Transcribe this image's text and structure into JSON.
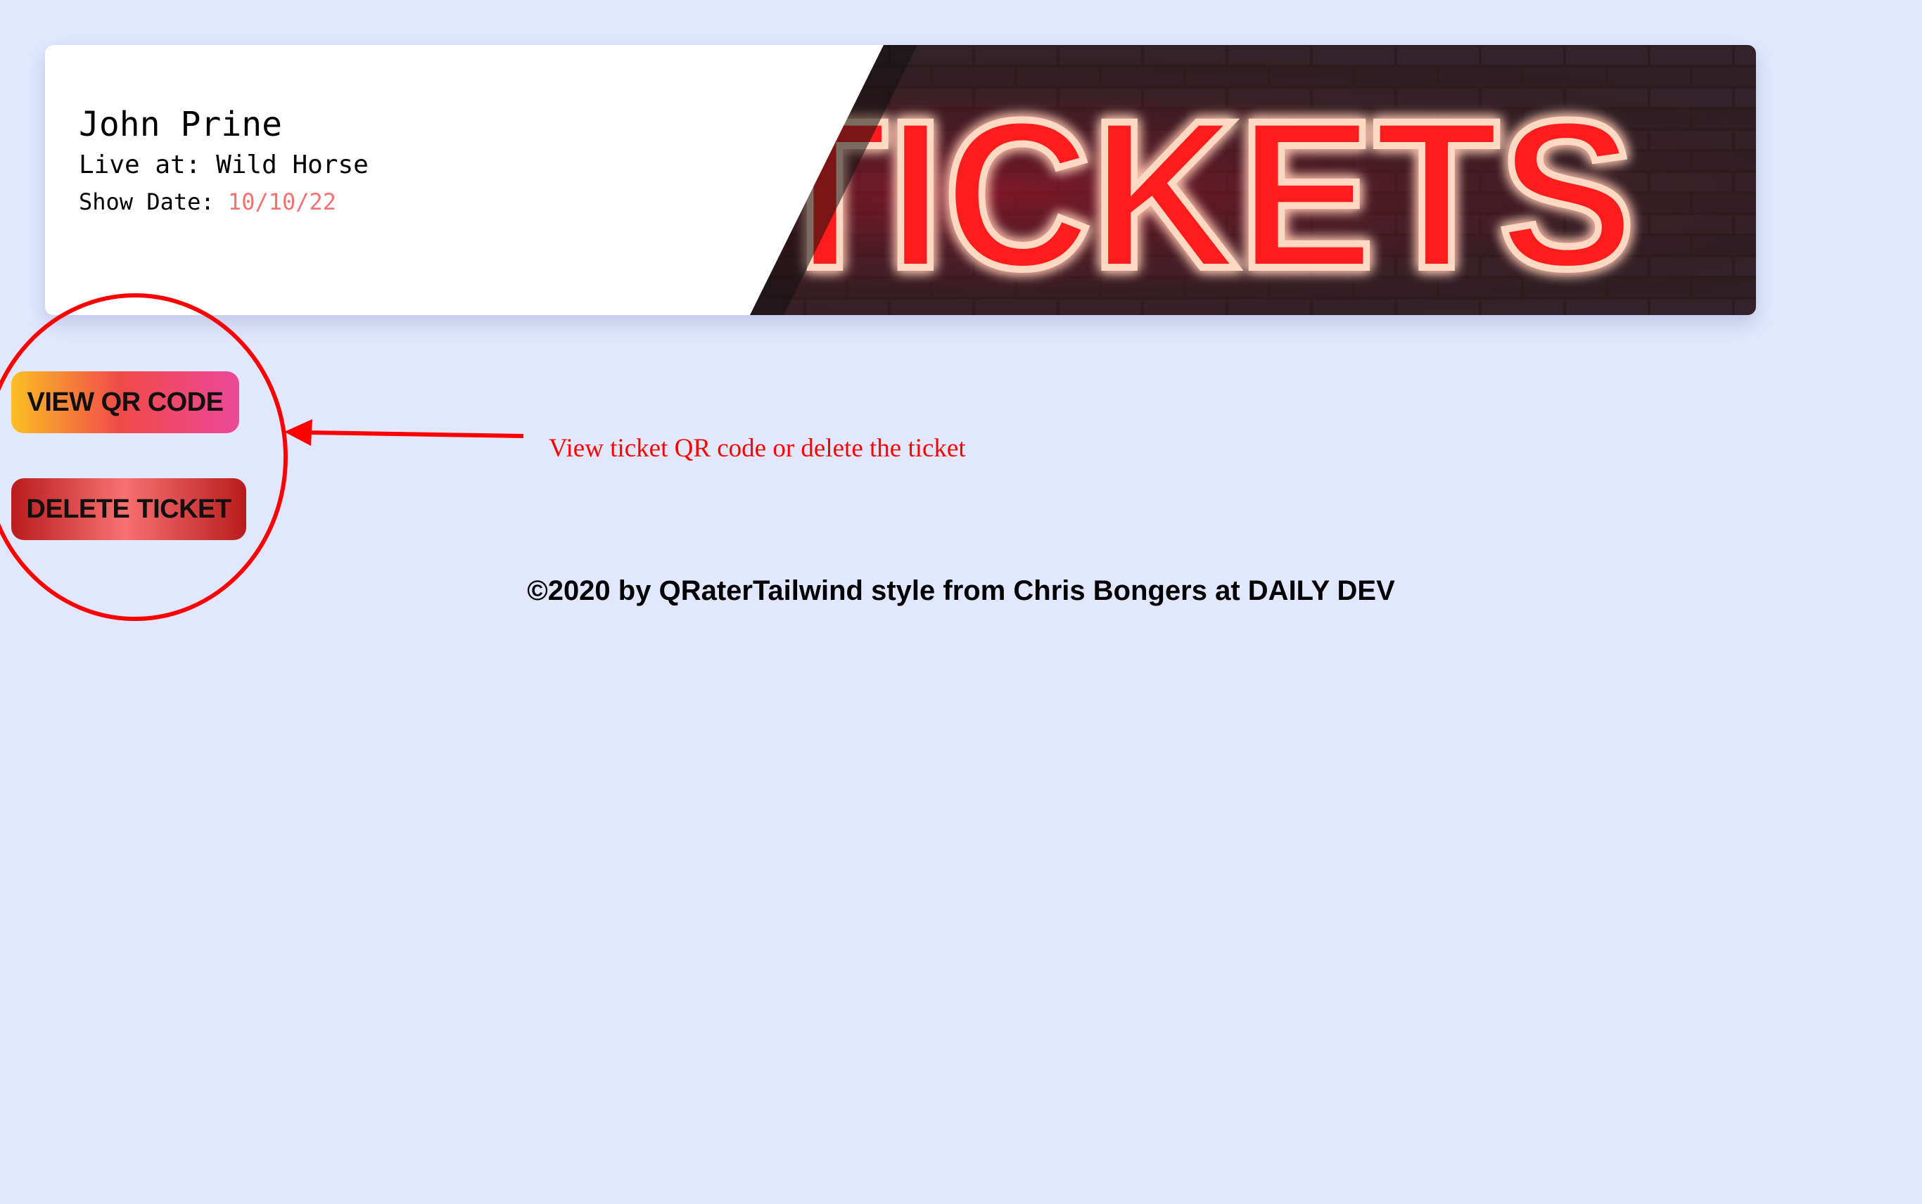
{
  "ticket": {
    "artist": "John Prine",
    "venue_label": "Live at:",
    "venue": "Wild Horse",
    "date_label": "Show Date:",
    "date": "10/10/22",
    "banner_text": "TICKETS"
  },
  "actions": {
    "view_qr_label": "VIEW QR CODE",
    "delete_label": "DELETE TICKET"
  },
  "annotation": {
    "text": "View ticket QR code or delete the ticket"
  },
  "footer": {
    "text": "©2020 by QRaterTailwind style from Chris Bongers at DAILY DEV"
  },
  "colors": {
    "page_background": "#e0e7ff",
    "date_accent": "#f87171",
    "annotation_red": "#ff0000",
    "neon_red": "#ff1a1a"
  }
}
